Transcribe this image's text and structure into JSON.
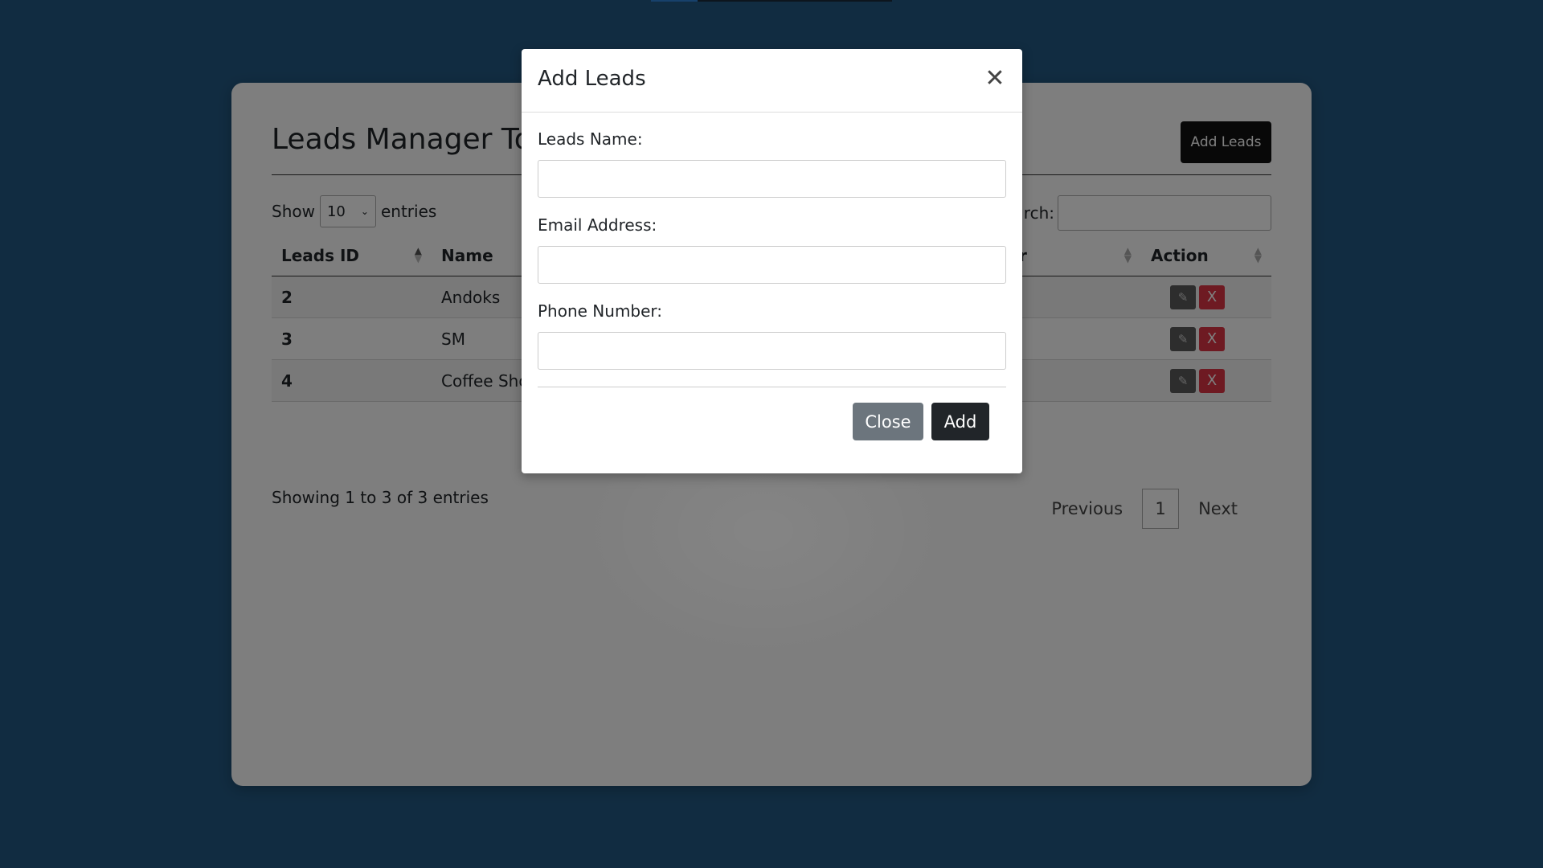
{
  "page": {
    "title": "Leads Manager To",
    "add_button": "Add Leads",
    "show_label": "Show",
    "entries_value": "10",
    "entries_label": "entries",
    "search_label": "rch:",
    "info": "Showing 1 to 3 of 3 entries"
  },
  "table": {
    "headers": [
      "Leads ID",
      "Name",
      "r",
      "Action"
    ],
    "rows": [
      {
        "id": "2",
        "name": "Andoks"
      },
      {
        "id": "3",
        "name": "SM"
      },
      {
        "id": "4",
        "name": "Coffee Sho"
      }
    ],
    "delete_label": "X"
  },
  "pagination": {
    "previous": "Previous",
    "current": "1",
    "next": "Next"
  },
  "modal": {
    "title": "Add Leads",
    "fields": {
      "name_label": "Leads Name:",
      "email_label": "Email Address:",
      "phone_label": "Phone Number:"
    },
    "close_label": "Close",
    "add_label": "Add"
  },
  "icons": {
    "close": "close-icon",
    "edit": "pencil-icon",
    "sort": "sort-icon"
  },
  "colors": {
    "background": "#235983",
    "danger": "#dc3545",
    "dark": "#212529",
    "secondary": "#6c757d"
  }
}
